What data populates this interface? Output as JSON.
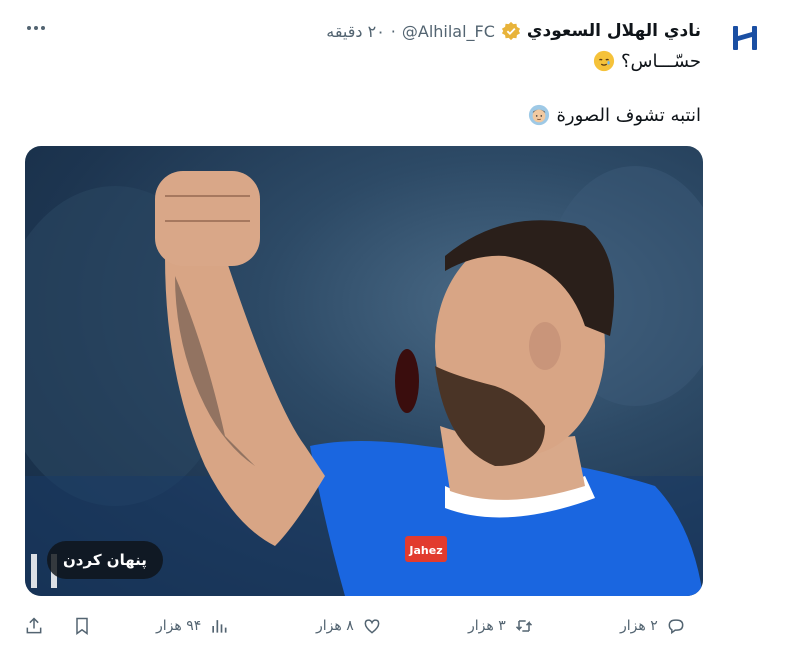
{
  "tweet": {
    "display_name": "نادي الهلال السعودي",
    "handle": "@Alhilal_FC",
    "separator": "·",
    "time": "۲۰ دقیقه",
    "text_line1": "حسّـــاس؟",
    "text_line2": "انتبه تشوف الصورة",
    "emoji1": "smiling-face-with-tear",
    "emoji2": "man-face-emoji",
    "verified_color": "#e8b33a"
  },
  "media": {
    "hide_label": "پنهان کردن",
    "jersey_sponsor": "Jahez",
    "kit_color": "#1a66e0"
  },
  "actions": {
    "reply_count": "۲ هزار",
    "retweet_count": "۳ هزار",
    "like_count": "۸ هزار",
    "views_count": "۹۴ هزار"
  }
}
